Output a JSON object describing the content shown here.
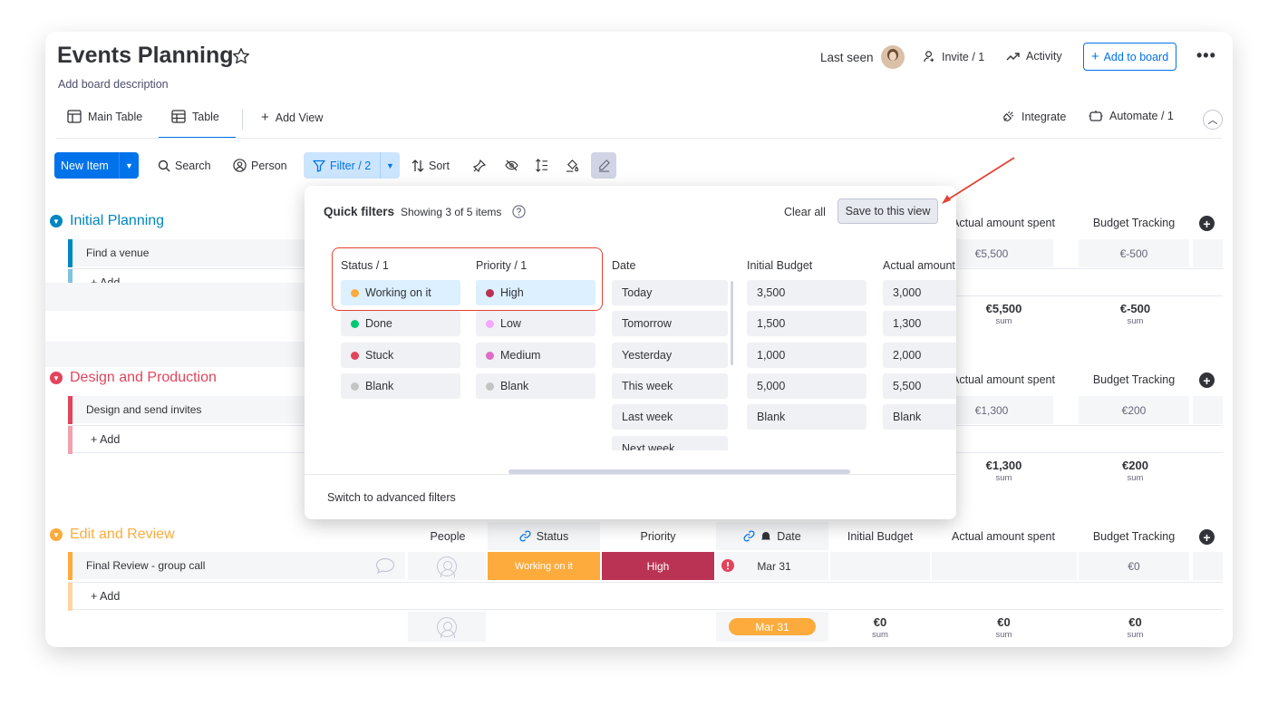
{
  "board": {
    "title": "Events Planning",
    "description": "Add board description",
    "last_seen": "Last seen",
    "invite": "Invite / 1",
    "activity": "Activity",
    "add_to_board": "Add to board"
  },
  "views": {
    "main_table": "Main Table",
    "table": "Table",
    "add_view": "Add View",
    "integrate": "Integrate",
    "automate": "Automate / 1"
  },
  "toolbar": {
    "new_item": "New Item",
    "search": "Search",
    "person": "Person",
    "filter": "Filter / 2",
    "sort": "Sort"
  },
  "columns": {
    "people": "People",
    "status": "Status",
    "priority": "Priority",
    "date": "Date",
    "initial_budget": "Initial Budget",
    "actual_amount": "Actual amount spent",
    "actual_amount_clipped": "Actual amount spent",
    "budget_tracking": "Budget Tracking"
  },
  "groups": [
    {
      "name": "Initial Planning",
      "color": "#0086c0",
      "item": "Find a venue",
      "actual": "€5,500",
      "tracking": "€-500",
      "sum_actual": "€5,500",
      "sum_tracking": "€-500",
      "sum_label": "sum",
      "add": "+ Add"
    },
    {
      "name": "Design and Production",
      "color": "#e2445c",
      "item": "Design and send invites",
      "actual": "€1,300",
      "tracking": "€200",
      "sum_actual": "€1,300",
      "sum_tracking": "€200",
      "sum_label": "sum",
      "add": "+ Add"
    },
    {
      "name": "Edit and Review",
      "color": "#fdab3d",
      "item": "Final Review - group call",
      "status": "Working on it",
      "priority": "High",
      "date": "Mar 31",
      "tracking": "€0",
      "sum_date": "Mar 31",
      "sum_initial": "€0",
      "sum_actual": "€0",
      "sum_tracking": "€0",
      "sum_label": "sum",
      "add": "+ Add"
    }
  ],
  "quick_filters": {
    "title": "Quick filters",
    "showing": "Showing 3 of 5 items",
    "clear_all": "Clear all",
    "save": "Save to this view",
    "switch": "Switch to advanced filters",
    "status_header": "Status / 1",
    "priority_header": "Priority / 1",
    "date_header": "Date",
    "initial_header": "Initial Budget",
    "actual_header": "Actual amount",
    "status_options": [
      {
        "label": "Working on it",
        "color": "#fdab3d",
        "selected": true
      },
      {
        "label": "Done",
        "color": "#00c875",
        "selected": false
      },
      {
        "label": "Stuck",
        "color": "#e2445c",
        "selected": false
      },
      {
        "label": "Blank",
        "color": "#c4c4c4",
        "selected": false
      }
    ],
    "priority_options": [
      {
        "label": "High",
        "color": "#bb3354",
        "selected": true
      },
      {
        "label": "Low",
        "color": "#f5a8ff",
        "selected": false
      },
      {
        "label": "Medium",
        "color": "#e06dc3",
        "selected": false
      },
      {
        "label": "Blank",
        "color": "#c4c4c4",
        "selected": false
      }
    ],
    "date_options": [
      "Today",
      "Tomorrow",
      "Yesterday",
      "This week",
      "Last week",
      "Next week"
    ],
    "initial_options": [
      "3,500",
      "1,500",
      "1,000",
      "5,000",
      "Blank"
    ],
    "actual_options": [
      "3,000",
      "1,300",
      "2,000",
      "5,500",
      "Blank"
    ]
  },
  "colors": {
    "primary": "#0073ea",
    "annotation": "#e44232"
  }
}
